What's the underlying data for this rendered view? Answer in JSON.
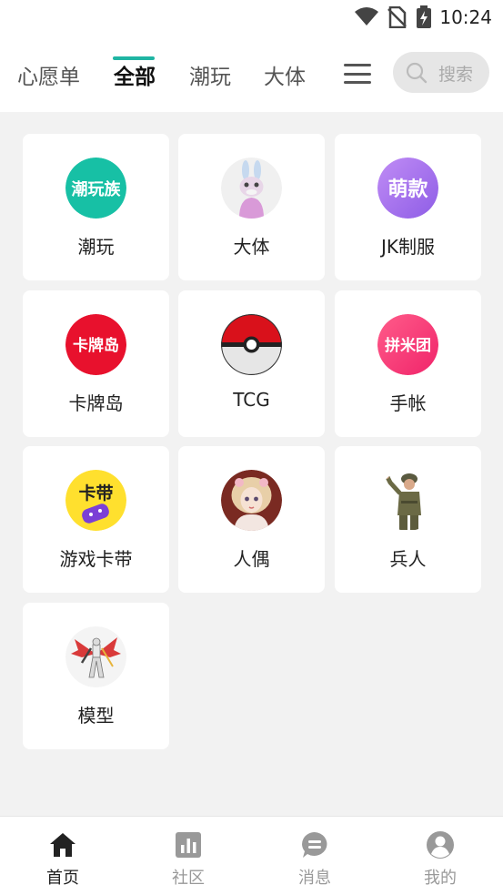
{
  "status_bar": {
    "time": "10:24"
  },
  "tabs": [
    {
      "label": "心愿单"
    },
    {
      "label": "全部"
    },
    {
      "label": "潮玩"
    },
    {
      "label": "大体"
    }
  ],
  "active_tab": "全部",
  "search": {
    "placeholder": "搜索"
  },
  "categories": [
    {
      "label": "潮玩",
      "icon": "潮玩族"
    },
    {
      "label": "大体",
      "icon": "rabbit-doll"
    },
    {
      "label": "JK制服",
      "icon": "萌款"
    },
    {
      "label": "卡牌岛",
      "icon": "卡牌岛"
    },
    {
      "label": "TCG",
      "icon": "pokeball"
    },
    {
      "label": "手帐",
      "icon": "拼米团"
    },
    {
      "label": "游戏卡带",
      "icon": "卡带"
    },
    {
      "label": "人偶",
      "icon": "doll"
    },
    {
      "label": "兵人",
      "icon": "soldier"
    },
    {
      "label": "模型",
      "icon": "mecha-model"
    }
  ],
  "bottom_nav": [
    {
      "label": "首页",
      "icon": "home-icon"
    },
    {
      "label": "社区",
      "icon": "chart-icon"
    },
    {
      "label": "消息",
      "icon": "chat-icon"
    },
    {
      "label": "我的",
      "icon": "user-icon"
    }
  ],
  "active_nav": "首页",
  "colors": {
    "accent": "#1fb5a3",
    "background": "#f2f2f2",
    "card": "#ffffff"
  }
}
